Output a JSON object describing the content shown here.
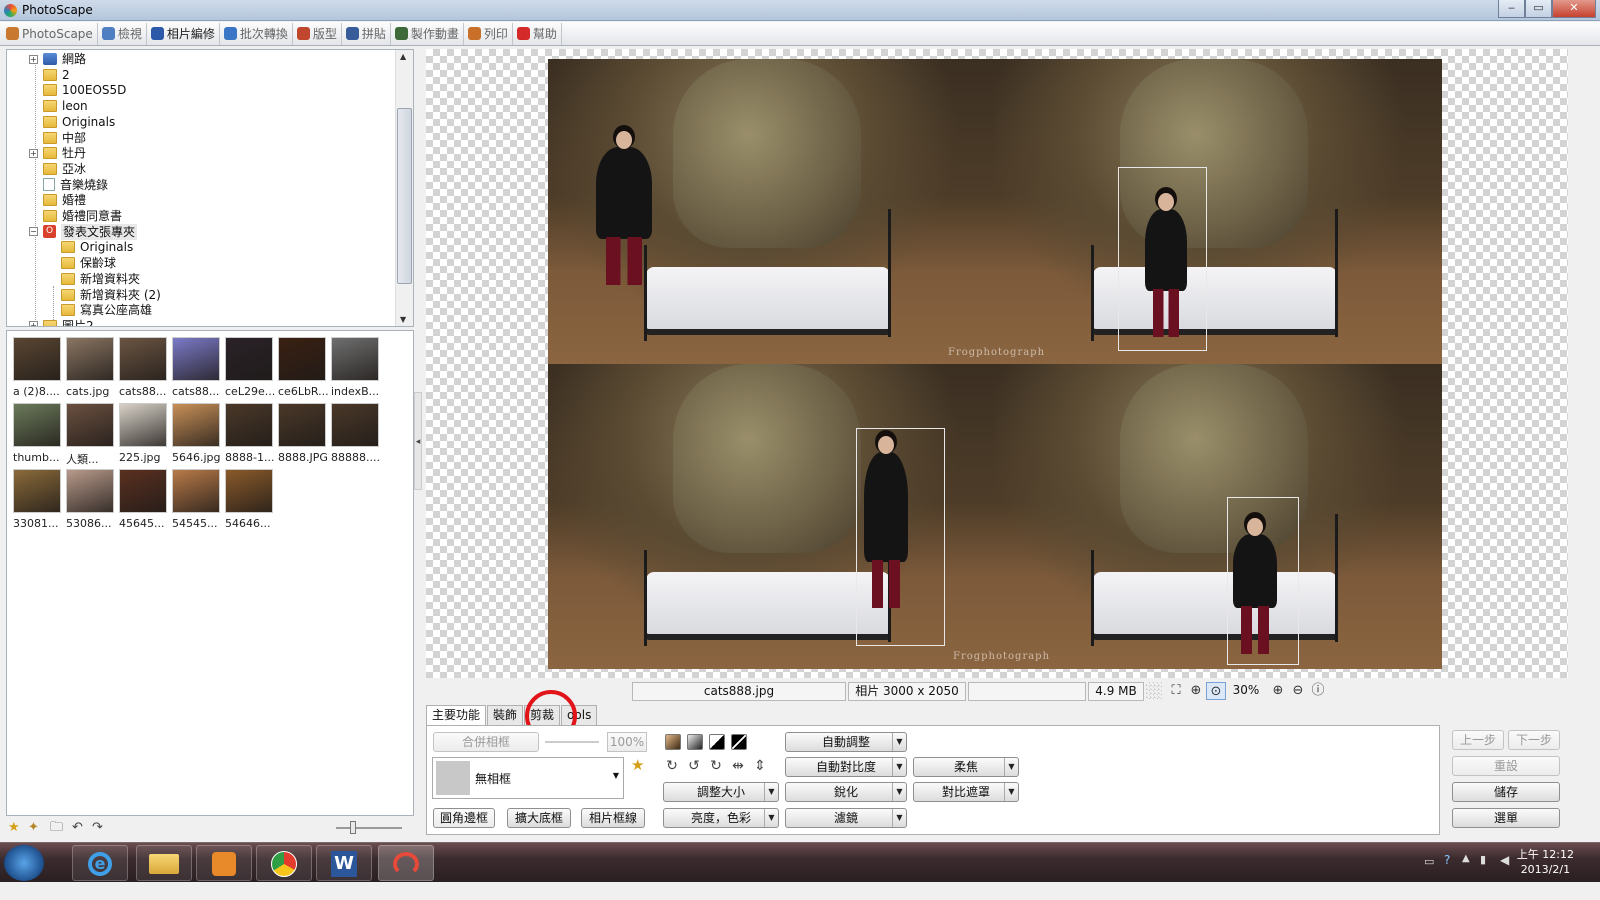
{
  "window": {
    "title": "PhotoScape",
    "min": "‒",
    "max": "▭",
    "close": "✕"
  },
  "menu": [
    {
      "label": "PhotoScape",
      "color": "#c9782f"
    },
    {
      "label": "檢視",
      "color": "#4f7fc0"
    },
    {
      "label": "相片編修",
      "color": "#2c5aa8"
    },
    {
      "label": "批次轉換",
      "color": "#3a76c5"
    },
    {
      "label": "版型",
      "color": "#c0462d"
    },
    {
      "label": "拼貼",
      "color": "#375c99"
    },
    {
      "label": "製作動畫",
      "color": "#3e6a3a"
    },
    {
      "label": "列印",
      "color": "#c86f2a"
    },
    {
      "label": "幫助",
      "color": "#d42a2a"
    }
  ],
  "tree": [
    {
      "label": "網路",
      "icon": "network-icon",
      "exp": "+"
    },
    {
      "label": "2",
      "icon": "folder-icon",
      "exp": ""
    },
    {
      "label": "100EOS5D",
      "icon": "folder-icon",
      "exp": ""
    },
    {
      "label": "leon",
      "icon": "folder-icon",
      "exp": ""
    },
    {
      "label": "Originals",
      "icon": "folder-icon",
      "exp": ""
    },
    {
      "label": "中部",
      "icon": "folder-icon",
      "exp": ""
    },
    {
      "label": "牡丹",
      "icon": "folder-icon",
      "exp": "+"
    },
    {
      "label": "亞冰",
      "icon": "folder-icon",
      "exp": ""
    },
    {
      "label": "音樂燒錄",
      "icon": "music-icon",
      "exp": ""
    },
    {
      "label": "婚禮",
      "icon": "folder-icon",
      "exp": ""
    },
    {
      "label": "婚禮同意書",
      "icon": "folder-icon",
      "exp": ""
    },
    {
      "label": "發表文張專夾",
      "icon": "special-folder-icon",
      "exp": "-"
    },
    {
      "label": "Originals",
      "icon": "folder-icon",
      "exp": "",
      "sub": true
    },
    {
      "label": "保齡球",
      "icon": "folder-icon",
      "exp": "",
      "sub": true
    },
    {
      "label": "新增資料夾",
      "icon": "folder-icon",
      "exp": "",
      "sub": true
    },
    {
      "label": "新增資料夾 (2)",
      "icon": "folder-icon",
      "exp": "",
      "sub": true
    },
    {
      "label": "寫真公座高雄",
      "icon": "folder-icon",
      "exp": "",
      "sub": true
    },
    {
      "label": "圖片2",
      "icon": "folder-icon",
      "exp": "+"
    }
  ],
  "thumbnails": [
    {
      "name": "a (2)8....",
      "color": "#5a4632"
    },
    {
      "name": "cats.jpg",
      "color": "#8a7562"
    },
    {
      "name": "cats88...",
      "color": "#6b5542"
    },
    {
      "name": "cats88...",
      "color": "#7b7ac8"
    },
    {
      "name": "ceL29e...",
      "color": "#2a2228"
    },
    {
      "name": "ce6LbR...",
      "color": "#3a2012"
    },
    {
      "name": "indexB...",
      "color": "#6f6f6f"
    },
    {
      "name": "thumb...",
      "color": "#6b7a5a"
    },
    {
      "name": "人類...",
      "color": "#6b5040"
    },
    {
      "name": "225.jpg",
      "color": "#d8d2c8"
    },
    {
      "name": "5646.jpg",
      "color": "#c89058"
    },
    {
      "name": "8888-1...",
      "color": "#4a3828"
    },
    {
      "name": "8888.JPG",
      "color": "#4a3828"
    },
    {
      "name": "88888....",
      "color": "#4a3828"
    },
    {
      "name": "33081...",
      "color": "#8a6a3a"
    },
    {
      "name": "53086...",
      "color": "#b89a8a"
    },
    {
      "name": "45645...",
      "color": "#5a3020"
    },
    {
      "name": "54545...",
      "color": "#b87a48"
    },
    {
      "name": "54646...",
      "color": "#8a5a2a"
    }
  ],
  "status": {
    "filename": "cats888.jpg",
    "dimensions": "相片 3000 x 2050",
    "blank": "",
    "size": "4.9 MB",
    "zoom": "30%"
  },
  "tabs": [
    {
      "label": "主要功能",
      "active": true
    },
    {
      "label": "裝飾",
      "active": false
    },
    {
      "label": "剪裁",
      "active": false
    },
    {
      "label": "ools",
      "active": false
    }
  ],
  "panel": {
    "merge_frame": "合併相框",
    "percent": "100%",
    "frame_select": "無相框",
    "round_frame": "圓角邊框",
    "expand_frame": "擴大底框",
    "photo_frame": "相片框線",
    "auto_adjust": "自動調整",
    "auto_contrast": "自動對比度",
    "soften": "柔焦",
    "resize": "調整大小",
    "sharpen": "銳化",
    "contrast_mask": "對比遮罩",
    "brightness_color": "亮度，色彩",
    "filter": "濾鏡"
  },
  "actions": {
    "undo": "上一步",
    "redo": "下一步",
    "reset": "重設",
    "save": "儲存",
    "menu": "選單"
  },
  "photo_watermark": "Frogphotograph",
  "clock": {
    "time": "上午 12:12",
    "date": "2013/2/1"
  }
}
